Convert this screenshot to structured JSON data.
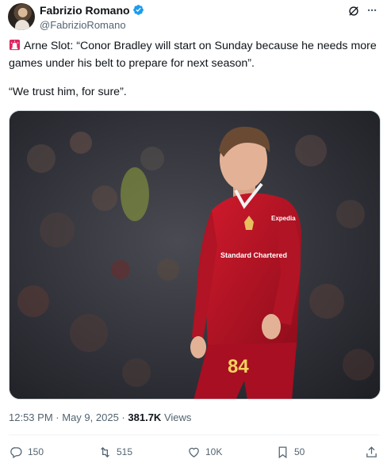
{
  "author": {
    "display_name": "Fabrizio Romano",
    "handle": "@FabrizioRomano",
    "verified": true,
    "verified_color": "#1d9bf0"
  },
  "header_icons": [
    "grok-icon",
    "more-icon"
  ],
  "tweet": {
    "line1": "Arne Slot: “Conor Bradley will start on Sunday because he needs more games under his belt to prepare for next season”.",
    "line2": "“We trust him, for sure”.",
    "leading_emoji": "siren-icon"
  },
  "photo": {
    "kit_number": "84",
    "sponsor": "Standard Chartered",
    "sleeve_sponsor": "Expedia",
    "kit_color": "#c8102e"
  },
  "meta": {
    "time": "12:53 PM",
    "separator": "·",
    "date": "May 9, 2025",
    "views_count": "381.7K",
    "views_label": "Views"
  },
  "actions": {
    "replies": "150",
    "reposts": "515",
    "likes": "10K",
    "bookmarks": "50"
  }
}
